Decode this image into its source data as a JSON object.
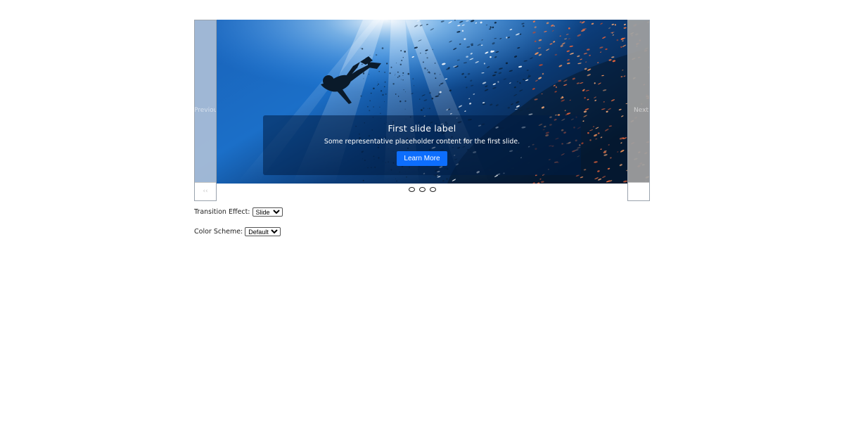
{
  "carousel": {
    "prev_label": "Previous",
    "next_label": "Next",
    "prev_icon": "chevron-left-icon",
    "next_icon": "chevron-right-icon",
    "active_index": 0,
    "slides": [
      {
        "title": "First slide label",
        "text": "Some representative placeholder content for the first slide.",
        "button": "Learn More"
      }
    ],
    "indicator_count": 3,
    "button_color": "#0d6efd"
  },
  "options": {
    "transition": {
      "label": "Transition Effect:",
      "selected": "Slide"
    },
    "color_scheme": {
      "label": "Color Scheme:",
      "selected": "Default"
    }
  }
}
